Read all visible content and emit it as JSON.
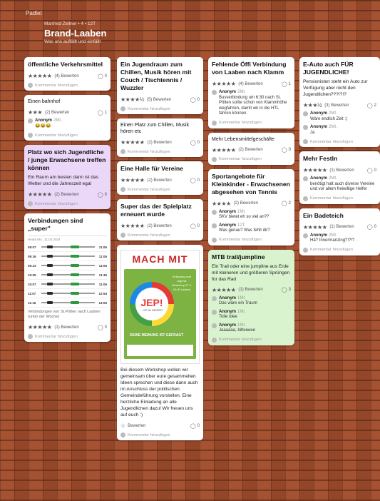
{
  "app": {
    "name": "Padlet"
  },
  "board": {
    "author": "Manfred Zeilner • 4 • 12T",
    "title": "Brand-Laaben",
    "subtitle": "Was uns auffällt und einfällt"
  },
  "labels": {
    "add_comment": "Kommentar hinzufügen"
  },
  "col1": [
    {
      "title": "öffentliche Verkehrsmittel",
      "stars": "★★★★★",
      "rating": "(4) Bewerten",
      "comments": "0"
    },
    {
      "title": "Einen bahnhof",
      "stars": "★★★",
      "rating": "(2) Bewerten",
      "comments": "1",
      "cmt_name": "Anonym",
      "cmt_time": "2Mt.",
      "cmt_text": "😂😂😂"
    },
    {
      "title": "Platz wo sich Jugendliche / junge Erwachsene treffen können",
      "body": "Ein Raum am besten dann ist das Wetter und die Jahreszeit egal",
      "stars": "★★★★★",
      "rating": "(2) Bewerten",
      "comments": "0"
    },
    {
      "title": "Verbindungen sind „super\"",
      "schedule_head": "Heute Mo., 11.03.2024",
      "rows": [
        {
          "dep": "09:07",
          "arr": "11:06"
        },
        {
          "dep": "09:16",
          "arr": "11:06"
        },
        {
          "dep": "09:23",
          "arr": "11:06"
        },
        {
          "dep": "10:05",
          "arr": "11:36"
        },
        {
          "dep": "10:07",
          "arr": "11:06"
        },
        {
          "dep": "11:07",
          "arr": "12:54"
        },
        {
          "dep": "11:16",
          "arr": "13:06"
        }
      ],
      "footnote": "Verbindungen von St.Pölten nach Laaben (unter der Woche)",
      "stars": "★★★★★",
      "rating": "(1) Bewerten",
      "comments": "0"
    }
  ],
  "col2": [
    {
      "title": "Ein Jugendraum zum Chillen, Musik hören mit Couch / Tischtennis / Wuzzler",
      "stars": "★★★★½",
      "rating": "(5) Bewerten",
      "comments": "0"
    },
    {
      "title": "Einen Platz zum Chillen, Musik hören etc",
      "stars": "★★★★★",
      "rating": "(2) Bewerten",
      "comments": "0"
    },
    {
      "title": "Eine Halle für Vereine",
      "stars": "★★★★★",
      "rating": "(2) Bewerten",
      "comments": "0"
    },
    {
      "title": "Super das der Spielplatz erneuert wurde",
      "stars": "★★★★★",
      "rating": "(2) Bewerten",
      "comments": "0"
    },
    {
      "poster_title": "MACH MIT",
      "poster_jep": "JEP!",
      "poster_jep_sub": "...ES IN DEINER",
      "poster_info": "Einladung zum Jugend-Workshop 27.4. 10:00 Laaben",
      "poster_meinung": "DEINE MEINUNG IST GEFRAGT",
      "body": "Bei diesem Workshop wollen wir gemeinsam über eure gesammelten Ideen sprechen und diese dann auch im Anschluss der politischen Gemeindeführung vorstellen. Eine herzliche Einladung an alle Jugendlichen dazu! Wir freuen uns auf euch :)",
      "rating": "Bewerten",
      "comments": "0"
    }
  ],
  "col3": [
    {
      "title": "Fehlende Öffi Verbindung von Laaben nach Klamm",
      "stars": "★★★★★",
      "rating": "(4) Bewerten",
      "comments": "1",
      "cmt_name": "Anonym",
      "cmt_time": "2Mt.",
      "cmt_text": "Busverbindung um 6:30 nach St. Pölten sollte schon von Klammhöhe wegfahren, damit wir in die HTL fahren können."
    },
    {
      "title": "Mehr Lebensmittelgeschäfte",
      "stars": "★★★★★",
      "rating": "(2) Bewerten",
      "comments": "0"
    },
    {
      "title": "Sportangebote für Kleinkinder - Erwachsenen abgesehen von Tennis",
      "stars": "★★★★",
      "rating": "(2) Bewerten",
      "comments": "2",
      "cmt1_name": "Anonym",
      "cmt1_time": "1Mt.",
      "cmt1_text": "SKV bietet eh so viel an??",
      "cmt2_name": "Anonym",
      "cmt2_time": "12T.",
      "cmt2_text": "Was genau? Was fehlt dir?"
    },
    {
      "title": "MTB trail/jumpline",
      "body": "Ein Trail oder eine jumpline aus Erde mit kleineren und größeren Sprüngen für das Rad",
      "stars": "★★★★★",
      "rating": "(1) Bewerten",
      "comments": "3",
      "cmt1_name": "Anonym",
      "cmt1_time": "1Mt.",
      "cmt1_text": "Das wäre ein Traum",
      "cmt2_name": "Anonym",
      "cmt2_time": "1Mt.",
      "cmt2_text": "Tolle Idee",
      "cmt3_name": "Anonym",
      "cmt3_time": "1Mt.",
      "cmt3_text": "Jaaaaaa, bitteeeee"
    }
  ],
  "col4": [
    {
      "title": "E-Auto auch FÜR JUGENDLICHE!",
      "body": "Pensionisten steht ein Auto zur Verfügung aber nicht den Jugendlichen???!?!?",
      "stars": "★★★½",
      "rating": "(3) Bewerten",
      "comments": "2",
      "cmt1_name": "Anonym",
      "cmt1_time": "2Mt.",
      "cmt1_text": "Wäre endlich Zeit :)",
      "cmt2_name": "Anonym",
      "cmt2_time": "2Mt.",
      "cmt2_text": "Ja"
    },
    {
      "title": "Mehr Festln",
      "stars": "★★★★★",
      "rating": "(1) Bewerten",
      "comments": "0",
      "cmt_name": "Anonym",
      "cmt_time": "2Mt.",
      "cmt_text": "benötigt halt auch diverse Vereine und vor allem freiwillige Helfer"
    },
    {
      "title": "Ein Badeteich",
      "stars": "★★★★★",
      "rating": "(1) Bewerten",
      "comments": "0",
      "cmt_name": "Anonym",
      "cmt_time": "2Mt.",
      "cmt_text": "Hä? Innermanzing?!?!?"
    }
  ]
}
